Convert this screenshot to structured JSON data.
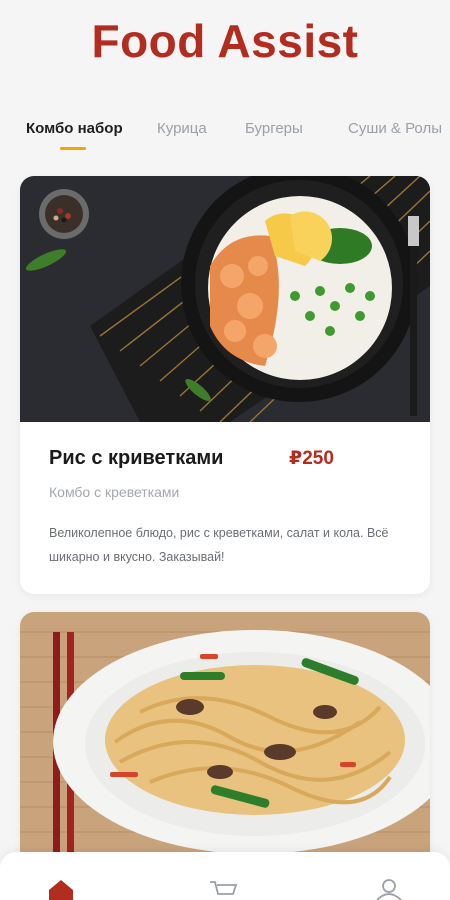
{
  "app": {
    "title": "Food Assist"
  },
  "tabs": [
    {
      "label": "Комбо набор",
      "active": true
    },
    {
      "label": "Курица",
      "active": false
    },
    {
      "label": "Бургеры",
      "active": false
    },
    {
      "label": "Суши & Ролы",
      "active": false
    }
  ],
  "cards": [
    {
      "image": "shrimp-rice-bowl-image",
      "name": "Рис с криветками",
      "price": "₽250",
      "subtitle": "Комбо с креветками",
      "description": "Великолепное блюдо, рис с креветками, салат и кола. Всё шикарно и вкусно. Заказывай!"
    },
    {
      "image": "noodles-plate-image"
    }
  ],
  "bottom_nav": [
    {
      "icon": "home-icon",
      "active": true
    },
    {
      "icon": "cart-icon",
      "active": false
    },
    {
      "icon": "profile-icon",
      "active": false
    }
  ],
  "colors": {
    "brand": "#b32c20",
    "tab_indicator": "#f0a800",
    "inactive": "#9aa0a8"
  }
}
